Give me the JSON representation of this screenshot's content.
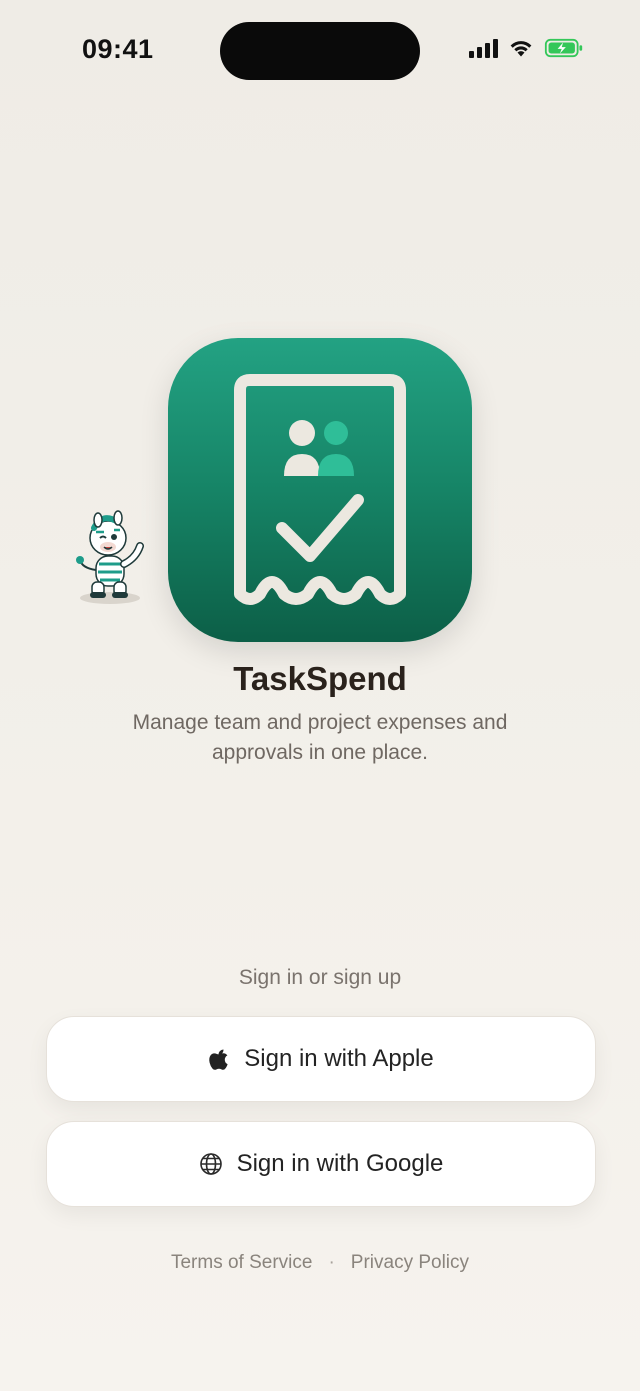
{
  "status_bar": {
    "time": "09:41"
  },
  "app": {
    "name": "TaskSpend",
    "tagline": "Manage team and project expenses and approvals in one place."
  },
  "auth": {
    "caption": "Sign in or sign up",
    "apple_label": "Sign in with Apple",
    "google_label": "Sign in with Google"
  },
  "footer": {
    "terms": "Terms of Service",
    "separator": "·",
    "privacy": "Privacy Policy"
  },
  "colors": {
    "accent": "#168466",
    "battery": "#34c759"
  }
}
